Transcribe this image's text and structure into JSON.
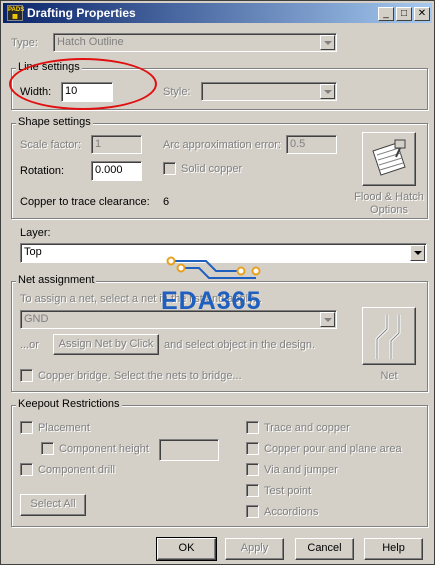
{
  "window": {
    "title": "Drafting Properties",
    "app_icon": "pads-app-icon"
  },
  "type": {
    "label": "Type:",
    "value": "Hatch Outline"
  },
  "line_settings": {
    "title": "Line settings",
    "width_label": "Width:",
    "width_value": "10",
    "style_label": "Style:",
    "style_value": ""
  },
  "shape_settings": {
    "title": "Shape settings",
    "scale_factor_label": "Scale factor:",
    "scale_factor_value": "1",
    "arc_error_label": "Arc approximation error:",
    "arc_error_value": "0.5",
    "rotation_label": "Rotation:",
    "rotation_value": "0.000",
    "solid_copper_label": "Solid copper",
    "clearance_label": "Copper to trace clearance:",
    "clearance_value": "6",
    "flood_button_line1": "Flood & Hatch",
    "flood_button_line2": "Options",
    "flood_icon": "flood-hatch-icon"
  },
  "layer": {
    "label": "Layer:",
    "value": "Top"
  },
  "net_assignment": {
    "title": "Net assignment",
    "instruction": "To assign a net, select a net in the list and apply...",
    "net_value": "GND",
    "or_label": "...or",
    "assign_button": "Assign Net by Click",
    "select_text": "and select object in the design.",
    "copper_bridge_label": "Copper bridge. Select the nets to bridge...",
    "net_button": "Net",
    "net_icon": "net-icon"
  },
  "keepout": {
    "title": "Keepout Restrictions",
    "left_items": [
      "Placement",
      "Component height",
      "Component drill"
    ],
    "right_items": [
      "Trace and copper",
      "Copper pour and plane area",
      "Via and jumper",
      "Test point",
      "Accordions"
    ],
    "select_all": "Select All"
  },
  "footer": {
    "ok": "OK",
    "apply": "Apply",
    "cancel": "Cancel",
    "help": "Help"
  },
  "watermark": {
    "text": "EDA365",
    "color": "#1f5fbf"
  },
  "colors": {
    "title_gradient_start": "#0a246a",
    "title_gradient_end": "#a6caf0",
    "annotation_red": "#e01010",
    "dialog_face": "#d4d0c8"
  }
}
